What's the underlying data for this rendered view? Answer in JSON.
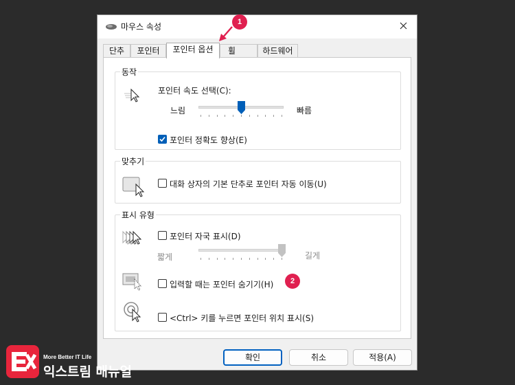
{
  "window": {
    "title": "마우스 속성",
    "close_icon": "close-icon"
  },
  "tabs": [
    {
      "label": "단추"
    },
    {
      "label": "포인터"
    },
    {
      "label": "포인터 옵션",
      "active": true
    },
    {
      "label": "휠"
    },
    {
      "label": "하드웨어"
    }
  ],
  "motion": {
    "title": "동작",
    "speed_label": "포인터 속도 선택(C):",
    "slow_label": "느림",
    "fast_label": "빠름",
    "speed_value": 0.5,
    "precision_label": "포인터 정확도 향상(E)",
    "precision_checked": true
  },
  "snap": {
    "title": "맞추기",
    "snap_label": "대화 상자의 기본 단추로 포인터 자동 이동(U)",
    "snap_checked": false
  },
  "visibility": {
    "title": "표시 유형",
    "trails_label": "포인터 자국 표시(D)",
    "trails_checked": false,
    "short_label": "짧게",
    "long_label": "길게",
    "trail_value": 1.0,
    "hide_label": "입력할 때는 포인터 숨기기(H)",
    "hide_checked": false,
    "ctrl_label": "<Ctrl> 키를 누르면 포인터 위치 표시(S)",
    "ctrl_checked": false
  },
  "buttons": {
    "ok": "확인",
    "cancel": "취소",
    "apply": "적용(A)"
  },
  "annotations": {
    "badge1": "1",
    "badge2": "2"
  },
  "watermark": {
    "tagline": "More Better IT Life",
    "brand": "익스트림 매뉴얼"
  },
  "colors": {
    "accent": "#005fb8",
    "badge": "#e02050",
    "logo": "#e8253c"
  }
}
